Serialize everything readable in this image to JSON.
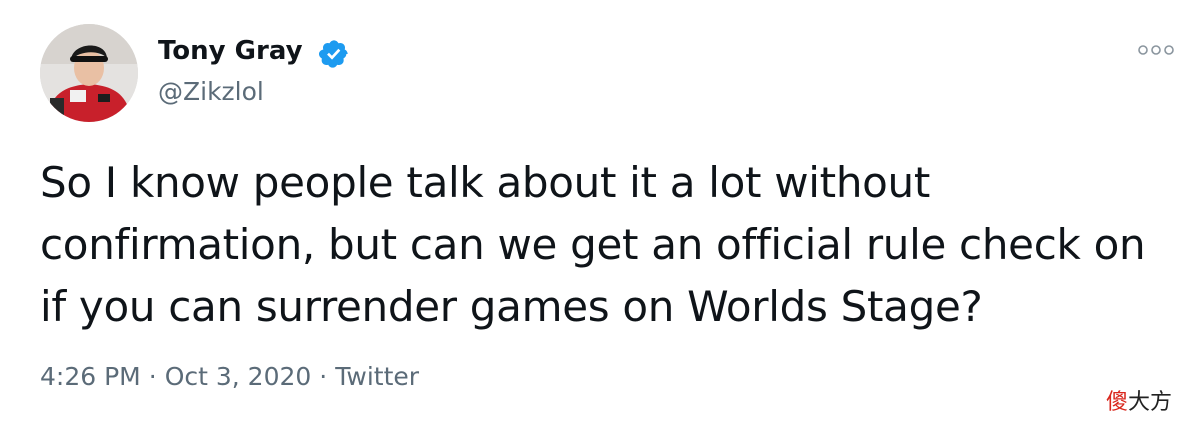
{
  "user": {
    "display_name": "Tony Gray",
    "handle": "@Zikzlol",
    "verified": true,
    "avatar_icon": "profile-photo"
  },
  "tweet": {
    "text": "So I know people talk about it a lot without confirmation, but can we get an official rule check on if you can surrender games on Worlds Stage?",
    "time": "4:26 PM",
    "date": "Oct 3, 2020",
    "source": "Twitter",
    "separator": "·"
  },
  "menu": {
    "icon": "more-options-icon"
  },
  "watermark": {
    "char1": "傻",
    "rest": "大方"
  },
  "colors": {
    "verified": "#1d9bf0",
    "text": "#0f1419",
    "secondary": "#5b6b78",
    "watermark_red": "#d9261c"
  }
}
